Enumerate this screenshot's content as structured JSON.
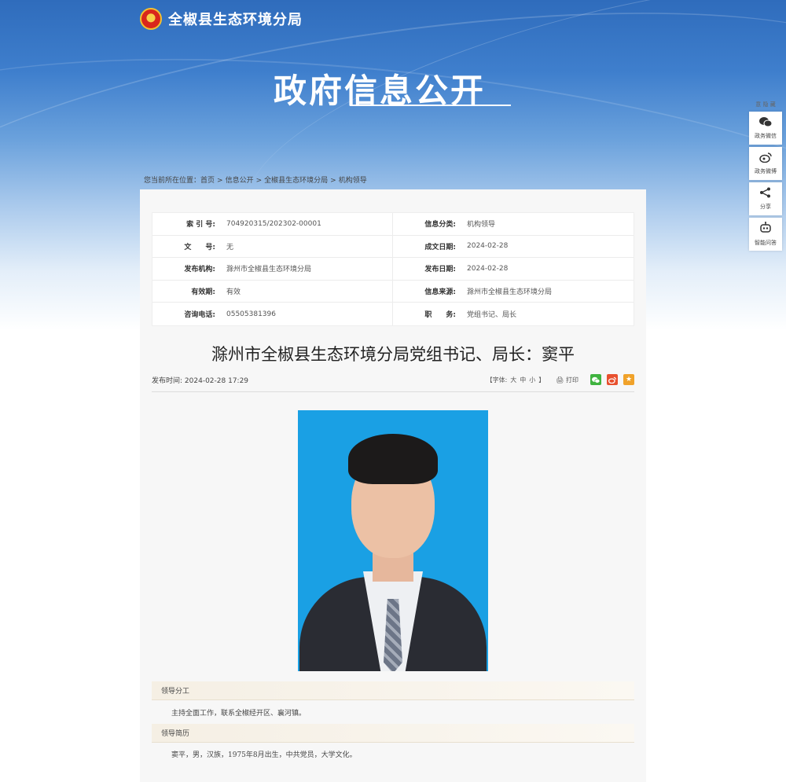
{
  "site": {
    "name": "全椒县生态环境分局",
    "banner_title": "政府信息公开"
  },
  "side_tools": {
    "top_label": "意 隐 藏",
    "items": [
      {
        "icon": "wechat-icon",
        "label": "政务微信"
      },
      {
        "icon": "weibo-icon",
        "label": "政务微博"
      },
      {
        "icon": "share-icon",
        "label": "分享"
      },
      {
        "icon": "robot-icon",
        "label": "智能问答"
      }
    ]
  },
  "breadcrumb": {
    "prefix": "您当前所在位置：",
    "items": [
      "首页",
      "信息公开",
      "全椒县生态环境分局",
      "机构领导"
    ],
    "separator": ">"
  },
  "meta": {
    "rows": [
      {
        "l_label": "索 引 号:",
        "l_value": "704920315/202302-00001",
        "r_label": "信息分类:",
        "r_value": "机构领导"
      },
      {
        "l_label": "文　　号:",
        "l_value": "无",
        "r_label": "成文日期:",
        "r_value": "2024-02-28"
      },
      {
        "l_label": "发布机构:",
        "l_value": "滁州市全椒县生态环境分局",
        "r_label": "发布日期:",
        "r_value": "2024-02-28"
      },
      {
        "l_label": "有效期:",
        "l_value": "有效",
        "r_label": "信息来源:",
        "r_value": "滁州市全椒县生态环境分局"
      },
      {
        "l_label": "咨询电话:",
        "l_value": "05505381396",
        "r_label": "职　　务:",
        "r_value": "党组书记、局长"
      }
    ]
  },
  "article": {
    "title": "滁州市全椒县生态环境分局党组书记、局长：窦平",
    "publish_label": "发布时间:",
    "publish_time": "2024-02-28 17:29",
    "font_prefix": "【字体:",
    "font_large": "大",
    "font_medium": "中",
    "font_small": "小",
    "font_suffix": "】",
    "print_label": "打印",
    "share_colors": {
      "wechat": "#3fb33f",
      "weibo": "#e8502f",
      "favorite": "#f0a22a"
    }
  },
  "sections": [
    {
      "heading": "领导分工",
      "body": "主持全面工作，联系全椒经开区、襄河镇。"
    },
    {
      "heading": "领导简历",
      "body": "窦平，男，汉族，1975年8月出生，中共党员，大学文化。"
    }
  ]
}
